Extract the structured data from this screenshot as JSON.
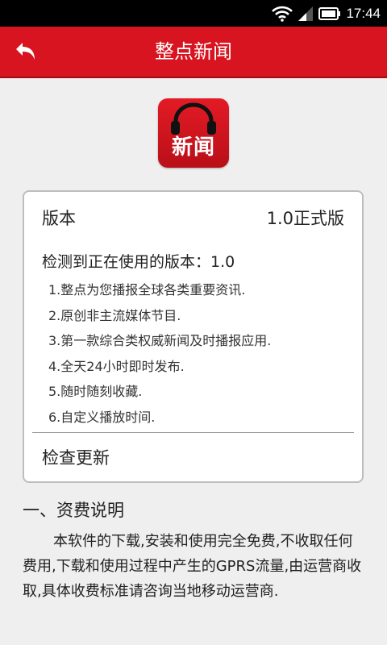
{
  "status_bar": {
    "time": "17:44"
  },
  "header": {
    "title": "整点新闻"
  },
  "logo": {
    "text": "新闻"
  },
  "version_card": {
    "version_label": "版本",
    "version_value": "1.0正式版",
    "detected_text": "检测到正在使用的版本：1.0",
    "features": [
      "1.整点为您播报全球各类重要资讯.",
      "2.原创非主流媒体节目.",
      "3.第一款综合类权威新闻及时播报应用.",
      "4.全天24小时即时发布.",
      "5.随时随刻收藏.",
      "6.自定义播放时间."
    ],
    "check_update_label": "检查更新"
  },
  "fee_section": {
    "title": "一、资费说明",
    "body": "本软件的下载,安装和使用完全免费,不收取任何费用,下载和使用过程中产生的GPRS流量,由运营商收取,具体收费标准请咨询当地移动运营商."
  },
  "colors": {
    "accent": "#d7141f",
    "status_bar": "#000000",
    "background": "#efefef"
  }
}
